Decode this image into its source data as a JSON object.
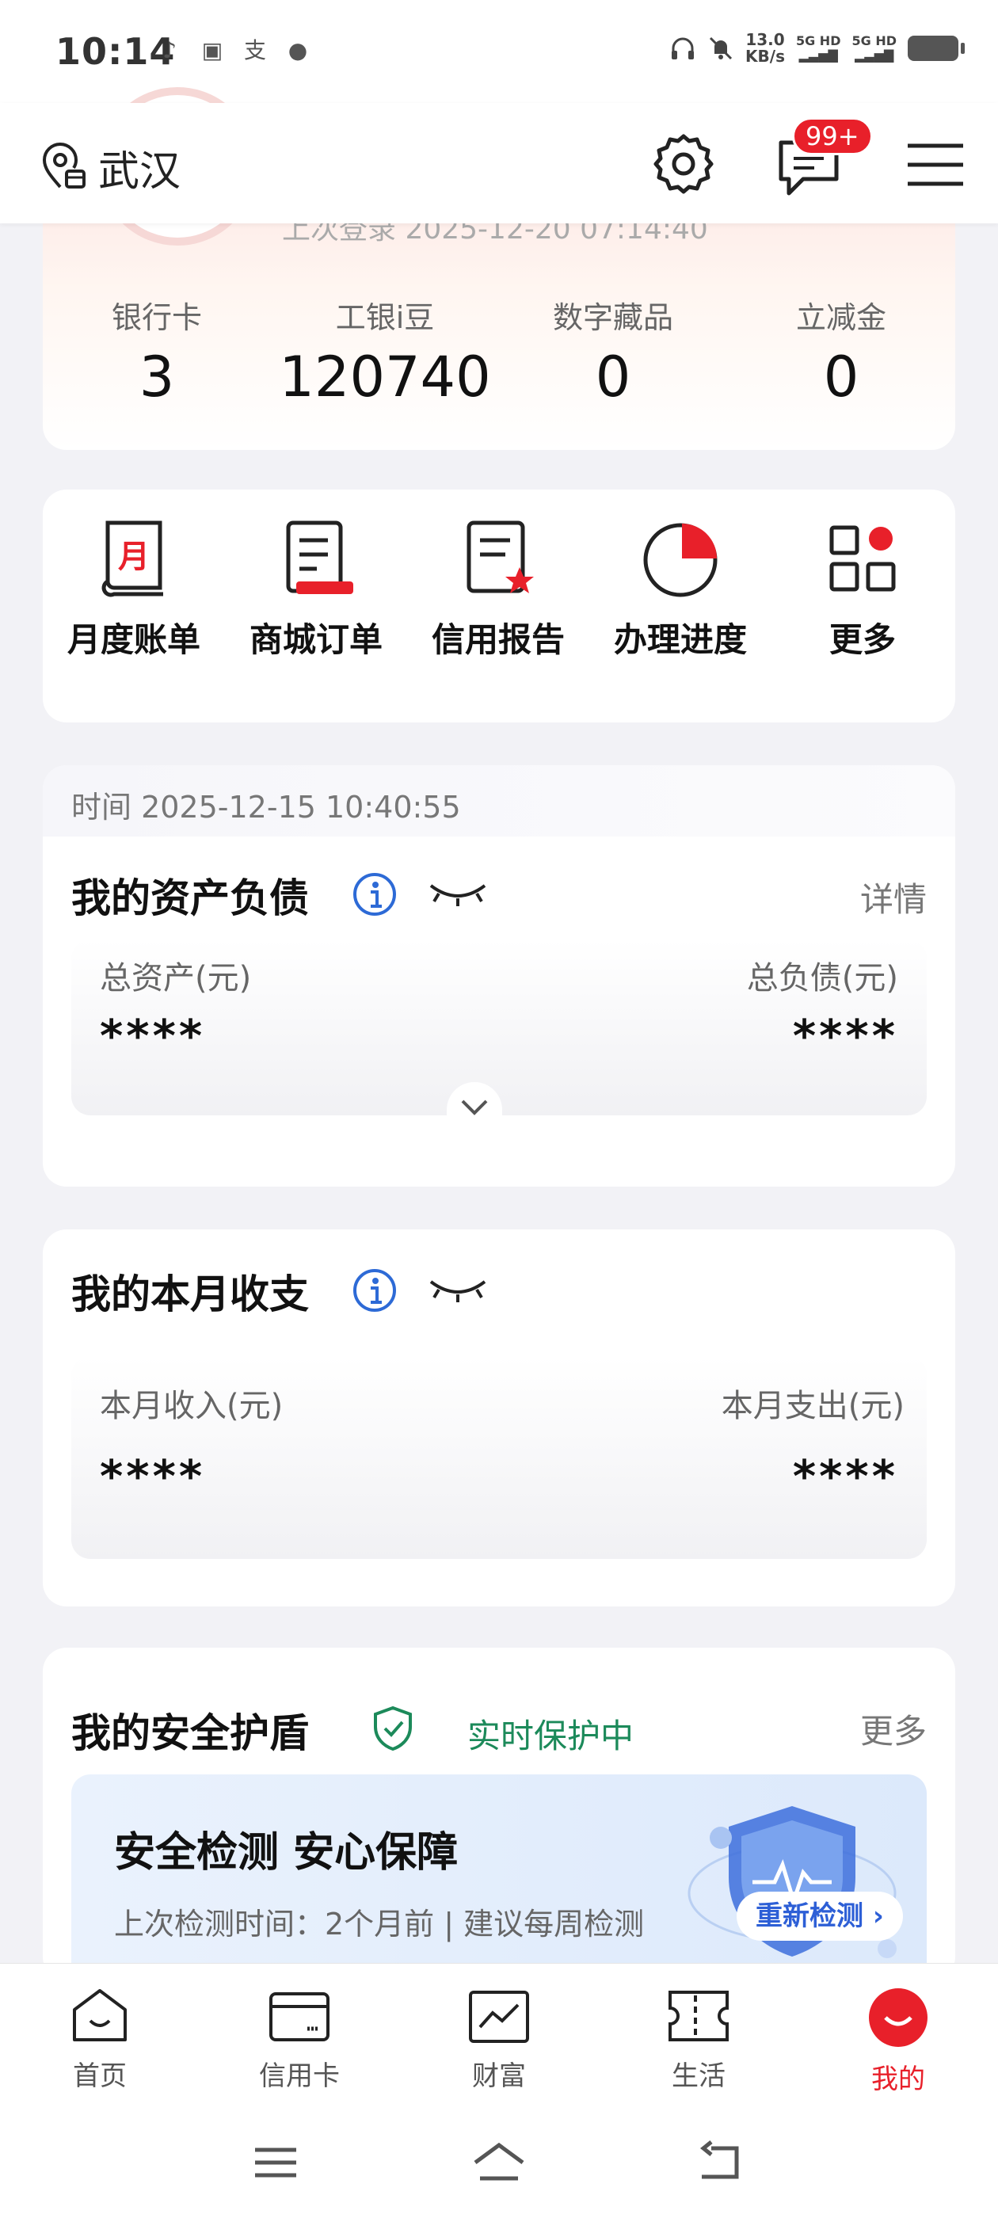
{
  "status_bar": {
    "time": "10:14",
    "speed_top": "13.0",
    "speed_unit": "KB/s",
    "sim1": "5G HD",
    "sim2": "5G HD"
  },
  "header": {
    "location": "武汉",
    "message_badge": "99+"
  },
  "profile": {
    "last_login": "上次登录 2025-12-20 07:14:40",
    "stats": [
      {
        "label": "银行卡",
        "value": "3"
      },
      {
        "label": "工银i豆",
        "value": "120740"
      },
      {
        "label": "数字藏品",
        "value": "0"
      },
      {
        "label": "立减金",
        "value": "0"
      }
    ]
  },
  "quick_actions": [
    {
      "label": "月度账单",
      "icon": "monthly-bill-icon"
    },
    {
      "label": "商城订单",
      "icon": "mall-order-icon"
    },
    {
      "label": "信用报告",
      "icon": "credit-report-icon"
    },
    {
      "label": "办理进度",
      "icon": "progress-icon"
    },
    {
      "label": "更多",
      "icon": "more-grid-icon"
    }
  ],
  "assets": {
    "timestamp": "时间 2025-12-15 10:40:55",
    "title": "我的资产负债",
    "detail": "详情",
    "total_assets_label": "总资产(元)",
    "total_assets_value": "****",
    "total_debt_label": "总负债(元)",
    "total_debt_value": "****"
  },
  "income": {
    "title": "我的本月收支",
    "income_label": "本月收入(元)",
    "income_value": "****",
    "expense_label": "本月支出(元)",
    "expense_value": "****"
  },
  "security": {
    "title": "我的安全护盾",
    "status": "实时保护中",
    "more": "更多",
    "banner_title": "安全检测 安心保障",
    "banner_sub": "上次检测时间：2个月前 | 建议每周检测",
    "recheck": "重新检测"
  },
  "bottom_nav": [
    {
      "label": "首页",
      "icon": "home-icon"
    },
    {
      "label": "信用卡",
      "icon": "credit-card-icon"
    },
    {
      "label": "财富",
      "icon": "wealth-icon"
    },
    {
      "label": "生活",
      "icon": "life-ticket-icon"
    },
    {
      "label": "我的",
      "icon": "profile-icon",
      "active": true
    }
  ],
  "colors": {
    "accent": "#e8202a",
    "safe_green": "#1c8a5a",
    "link_blue": "#2d5fd6"
  }
}
